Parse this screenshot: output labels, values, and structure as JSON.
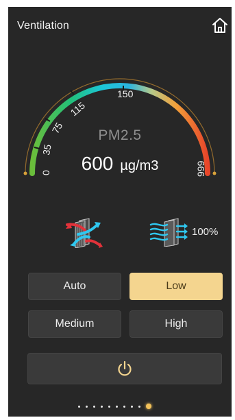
{
  "header": {
    "title": "Ventilation",
    "home_icon": "home-icon"
  },
  "gauge": {
    "label": "PM2.5",
    "value": "600",
    "unit": "µg/m3",
    "scale_labels": [
      "0",
      "35",
      "75",
      "115",
      "150",
      "999"
    ],
    "scale_min": 0,
    "scale_max": 999
  },
  "status": {
    "filter_icon": "air-exchange-icon",
    "fan_icon": "fan-flow-icon",
    "fan_speed": "100%"
  },
  "modes": {
    "auto": "Auto",
    "low": "Low",
    "medium": "Medium",
    "high": "High",
    "active": "Low"
  },
  "power": {
    "icon": "power-icon"
  },
  "pager": {
    "count": 10,
    "active_index": 9
  },
  "colors": {
    "background": "#272727",
    "accent": "#f4d58f",
    "button": "#3a3a3a",
    "gauge_green": "#21c27a",
    "gauge_cyan": "#1cc6d8",
    "gauge_orange": "#f08a2a",
    "gauge_red": "#e8452a"
  }
}
